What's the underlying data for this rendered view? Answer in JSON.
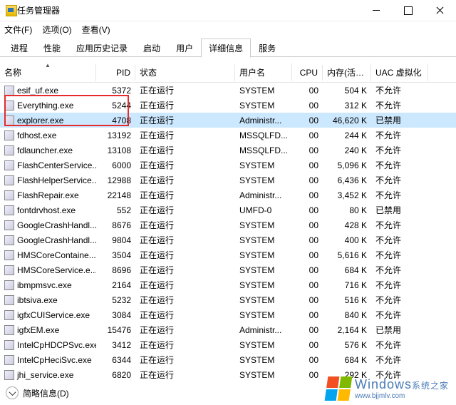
{
  "window": {
    "title": "任务管理器"
  },
  "menu": {
    "file": "文件(F)",
    "options": "选项(O)",
    "view": "查看(V)"
  },
  "tabs": {
    "items": [
      "进程",
      "性能",
      "应用历史记录",
      "启动",
      "用户",
      "详细信息",
      "服务"
    ],
    "active_index": 5
  },
  "columns": {
    "name": "名称",
    "pid": "PID",
    "status": "状态",
    "user": "用户名",
    "cpu": "CPU",
    "mem": "内存(活动...",
    "uac": "UAC 虚拟化"
  },
  "status_running": "正在运行",
  "uac": {
    "disallow": "不允许",
    "disabled": "已禁用"
  },
  "rows": [
    {
      "name": "esif_uf.exe",
      "pid": "5372",
      "user": "SYSTEM",
      "cpu": "00",
      "mem": "504 K",
      "uac": "disallow"
    },
    {
      "name": "Everything.exe",
      "pid": "5244",
      "user": "SYSTEM",
      "cpu": "00",
      "mem": "312 K",
      "uac": "disallow"
    },
    {
      "name": "explorer.exe",
      "pid": "4708",
      "user": "Administr...",
      "cpu": "00",
      "mem": "46,620 K",
      "uac": "disabled",
      "selected": true
    },
    {
      "name": "fdhost.exe",
      "pid": "13192",
      "user": "MSSQLFD...",
      "cpu": "00",
      "mem": "244 K",
      "uac": "disallow"
    },
    {
      "name": "fdlauncher.exe",
      "pid": "13108",
      "user": "MSSQLFD...",
      "cpu": "00",
      "mem": "240 K",
      "uac": "disallow"
    },
    {
      "name": "FlashCenterService...",
      "pid": "6000",
      "user": "SYSTEM",
      "cpu": "00",
      "mem": "5,096 K",
      "uac": "disallow"
    },
    {
      "name": "FlashHelperService...",
      "pid": "12988",
      "user": "SYSTEM",
      "cpu": "00",
      "mem": "6,436 K",
      "uac": "disallow"
    },
    {
      "name": "FlashRepair.exe",
      "pid": "22148",
      "user": "Administr...",
      "cpu": "00",
      "mem": "3,452 K",
      "uac": "disallow"
    },
    {
      "name": "fontdrvhost.exe",
      "pid": "552",
      "user": "UMFD-0",
      "cpu": "00",
      "mem": "80 K",
      "uac": "disabled"
    },
    {
      "name": "GoogleCrashHandl...",
      "pid": "8676",
      "user": "SYSTEM",
      "cpu": "00",
      "mem": "428 K",
      "uac": "disallow"
    },
    {
      "name": "GoogleCrashHandl...",
      "pid": "9804",
      "user": "SYSTEM",
      "cpu": "00",
      "mem": "400 K",
      "uac": "disallow"
    },
    {
      "name": "HMSCoreContaine...",
      "pid": "3504",
      "user": "SYSTEM",
      "cpu": "00",
      "mem": "5,616 K",
      "uac": "disallow"
    },
    {
      "name": "HMSCoreService.e...",
      "pid": "8696",
      "user": "SYSTEM",
      "cpu": "00",
      "mem": "684 K",
      "uac": "disallow"
    },
    {
      "name": "ibmpmsvc.exe",
      "pid": "2164",
      "user": "SYSTEM",
      "cpu": "00",
      "mem": "716 K",
      "uac": "disallow"
    },
    {
      "name": "ibtsiva.exe",
      "pid": "5232",
      "user": "SYSTEM",
      "cpu": "00",
      "mem": "516 K",
      "uac": "disallow"
    },
    {
      "name": "igfxCUIService.exe",
      "pid": "3084",
      "user": "SYSTEM",
      "cpu": "00",
      "mem": "840 K",
      "uac": "disallow"
    },
    {
      "name": "igfxEM.exe",
      "pid": "15476",
      "user": "Administr...",
      "cpu": "00",
      "mem": "2,164 K",
      "uac": "disabled"
    },
    {
      "name": "IntelCpHDCPSvc.exe",
      "pid": "3412",
      "user": "SYSTEM",
      "cpu": "00",
      "mem": "576 K",
      "uac": "disallow"
    },
    {
      "name": "IntelCpHeciSvc.exe",
      "pid": "6344",
      "user": "SYSTEM",
      "cpu": "00",
      "mem": "684 K",
      "uac": "disallow"
    },
    {
      "name": "jhi_service.exe",
      "pid": "6820",
      "user": "SYSTEM",
      "cpu": "00",
      "mem": "292 K",
      "uac": "disallow"
    }
  ],
  "brief": "简略信息(D)",
  "watermark": {
    "line1": "Windows",
    "suffix": "系统之家",
    "line2": "www.bjjmlv.com"
  }
}
